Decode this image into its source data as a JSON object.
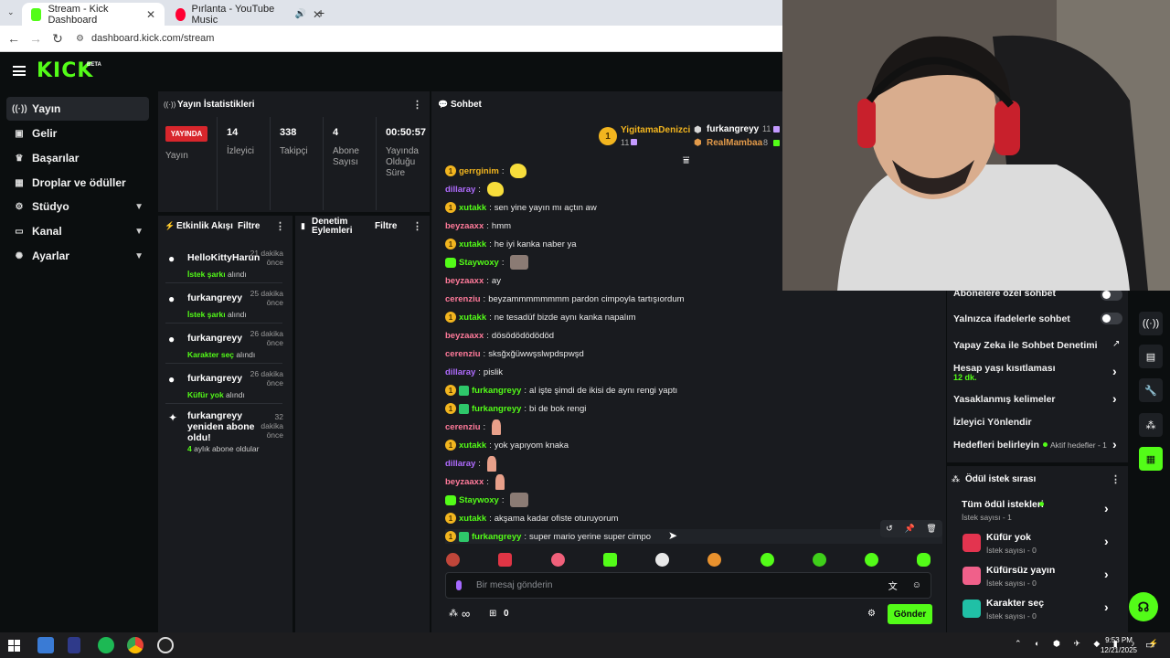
{
  "browser": {
    "tabs": [
      {
        "title": "Stream - Kick Dashboard",
        "active": true
      },
      {
        "title": "Pırlanta - YouTube Music",
        "active": false
      }
    ],
    "url": "dashboard.kick.com/stream"
  },
  "header": {
    "logo": "KICK",
    "beta": "BETA"
  },
  "sidebar": {
    "items": [
      {
        "label": "Yayın",
        "icon": "broadcast-icon",
        "active": true
      },
      {
        "label": "Gelir",
        "icon": "revenue-icon"
      },
      {
        "label": "Başarılar",
        "icon": "trophy-icon"
      },
      {
        "label": "Droplar ve ödüller",
        "icon": "gift-icon"
      },
      {
        "label": "Stüdyo",
        "icon": "studio-icon",
        "expandable": true
      },
      {
        "label": "Kanal",
        "icon": "channel-icon",
        "expandable": true
      },
      {
        "label": "Ayarlar",
        "icon": "gear-icon",
        "expandable": true
      }
    ]
  },
  "stats": {
    "title": "Yayın İstatistikleri",
    "status": "YAYINDA",
    "status_label": "Yayın",
    "viewers": "14",
    "viewers_label": "İzleyici",
    "followers": "338",
    "followers_label": "Takipçi",
    "subs": "4",
    "subs_label1": "Abone",
    "subs_label2": "Sayısı",
    "duration": "00:50:57",
    "duration_label1": "Yayında",
    "duration_label2": "Olduğu",
    "duration_label3": "Süre"
  },
  "events": {
    "title": "Etkinlik Akışı",
    "filter": "Filtre",
    "items": [
      {
        "user": "HelloKittyHarun",
        "t1": "21 dakika",
        "t2": "önce",
        "reward": "İstek şarkı",
        "suffix": "alındı"
      },
      {
        "user": "furkangreyy",
        "t1": "25 dakika",
        "t2": "önce",
        "reward": "İstek şarkı",
        "suffix": "alındı"
      },
      {
        "user": "furkangreyy",
        "t1": "26 dakika",
        "t2": "önce",
        "reward": "Karakter seç",
        "suffix": "alındı"
      },
      {
        "user": "furkangreyy",
        "t1": "26 dakika",
        "t2": "önce",
        "reward": "Küfür yok",
        "suffix": "alındı"
      }
    ],
    "resub": {
      "l1": "furkangreyy",
      "l2": "yeniden abone",
      "l3": "oldu!",
      "t1": "32",
      "t2": "dakika",
      "t3": "önce",
      "months": "4",
      "months_suffix": "aylık abone oldular"
    }
  },
  "moderation": {
    "title1": "Denetim",
    "title2": "Eylemleri",
    "filter": "Filtre"
  },
  "chat": {
    "title": "Sohbet",
    "top_gifters": [
      {
        "name": "YigitamaDenizci",
        "count": "11"
      },
      {
        "name": "furkangreyy",
        "count": "11"
      },
      {
        "name": "RealMambaa",
        "count": "8"
      }
    ],
    "messages": [
      {
        "user": "gerrginim",
        "color": "#f2b51f",
        "badge": "coin",
        "text": "",
        "emote": "duck"
      },
      {
        "user": "dillaray",
        "color": "#b06cff",
        "badge": "",
        "text": "",
        "emote": "duck"
      },
      {
        "user": "xutakk",
        "color": "#53fc18",
        "badge": "coin",
        "text": "sen yine yayın mı açtın aw"
      },
      {
        "user": "beyzaaxx",
        "color": "#ff7a9a",
        "badge": "",
        "text": "hmm"
      },
      {
        "user": "xutakk",
        "color": "#53fc18",
        "badge": "coin",
        "text": "he iyi kanka naber ya"
      },
      {
        "user": "Staywoxy",
        "color": "#53fc18",
        "badge": "sub",
        "text": "",
        "emote": "cat"
      },
      {
        "user": "beyzaaxx",
        "color": "#ff7a9a",
        "badge": "",
        "text": "ay"
      },
      {
        "user": "cerenziu",
        "color": "#ff7a9a",
        "badge": "",
        "text": "beyzammmmmmmm pardon cimpoyla tartışıordum"
      },
      {
        "user": "xutakk",
        "color": "#53fc18",
        "badge": "coin",
        "text": "ne tesadüf bizde aynı kanka napalım"
      },
      {
        "user": "beyzaaxx",
        "color": "#ff7a9a",
        "badge": "",
        "text": "dösödödödödöd"
      },
      {
        "user": "cerenziu",
        "color": "#ff7a9a",
        "badge": "",
        "text": "sksğxğüwwşslwpdspwşd"
      },
      {
        "user": "dillaray",
        "color": "#b06cff",
        "badge": "",
        "text": "pislik"
      },
      {
        "user": "furkangreyy",
        "color": "#53fc18",
        "badge": "coin+shield",
        "text": "al işte şimdi de ikisi de aynı rengi yaptı"
      },
      {
        "user": "furkangreyy",
        "color": "#53fc18",
        "badge": "coin+shield",
        "text": "bi de bok rengi"
      },
      {
        "user": "cerenziu",
        "color": "#ff7a9a",
        "badge": "",
        "text": "",
        "emote": "finger"
      },
      {
        "user": "xutakk",
        "color": "#53fc18",
        "badge": "coin",
        "text": "yok yapıyom knaka"
      },
      {
        "user": "dillaray",
        "color": "#b06cff",
        "badge": "",
        "text": "",
        "emote": "finger"
      },
      {
        "user": "beyzaaxx",
        "color": "#ff7a9a",
        "badge": "",
        "text": "",
        "emote": "finger"
      },
      {
        "user": "Staywoxy",
        "color": "#53fc18",
        "badge": "sub",
        "text": "",
        "emote": "cat"
      },
      {
        "user": "xutakk",
        "color": "#53fc18",
        "badge": "coin",
        "text": "akşama kadar ofiste oturuyorum"
      },
      {
        "user": "furkangreyy",
        "color": "#53fc18",
        "badge": "coin+shield",
        "text": "super mario yerine super cimpo"
      }
    ],
    "input_placeholder": "Bir mesaj gönderin",
    "points": "∞",
    "points2": "0",
    "send": "Gönder"
  },
  "chat_settings": {
    "items": [
      {
        "label": "Abonelere özel sohbet",
        "type": "toggle"
      },
      {
        "label": "Yalnızca ifadelerle sohbet",
        "type": "toggle"
      },
      {
        "label": "Yapay Zeka ile Sohbet Denetimi",
        "type": "external"
      },
      {
        "label": "Hesap yaşı kısıtlaması",
        "sub": "12 dk.",
        "type": "chevron"
      },
      {
        "label": "Yasaklanmış kelimeler",
        "type": "chevron"
      },
      {
        "label": "İzleyici Yönlendir",
        "type": "none"
      },
      {
        "label": "Hedefleri belirleyin",
        "right": "Aktif hedefler - 1",
        "type": "chevron"
      }
    ]
  },
  "rewards": {
    "title": "Ödül istek sırası",
    "items": [
      {
        "title": "Tüm ödül istekleri",
        "sub": "İstek sayısı - 1",
        "color": ""
      },
      {
        "title": "Küfür yok",
        "sub": "İstek sayısı - 0",
        "color": "#e3344f"
      },
      {
        "title": "Küfürsüz yayın",
        "sub": "İstek sayısı - 0",
        "color": "#f0608a"
      },
      {
        "title": "Karakter seç",
        "sub": "İstek sayısı - 0",
        "color": "#20c0a6"
      }
    ]
  },
  "taskbar": {
    "time": "9:53 PM",
    "date": "12/21/2025"
  }
}
